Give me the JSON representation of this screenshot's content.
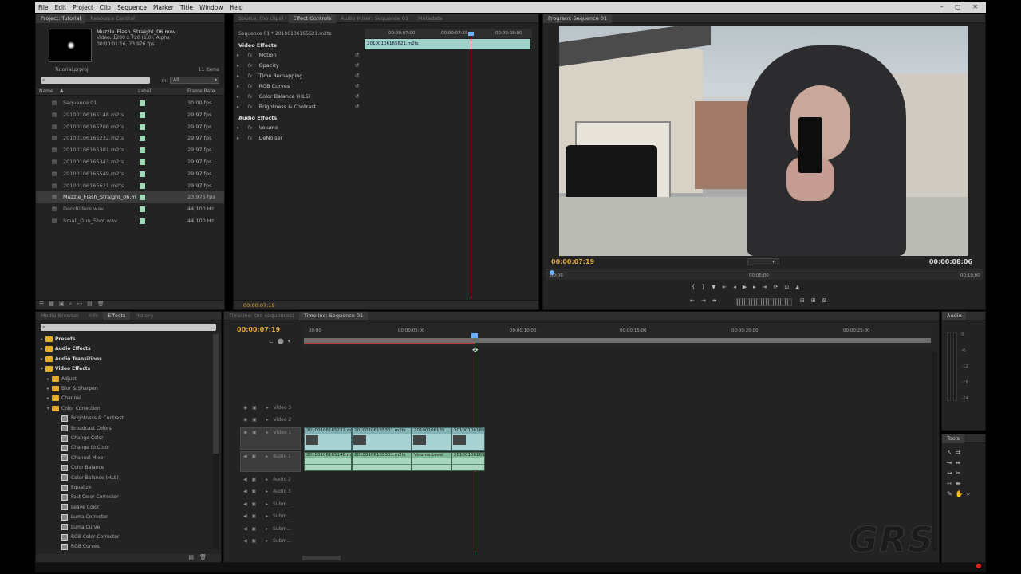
{
  "menu": [
    "File",
    "Edit",
    "Project",
    "Clip",
    "Sequence",
    "Marker",
    "Title",
    "Window",
    "Help"
  ],
  "project_panel": {
    "tabs": [
      "Project: Tutorial",
      "Resource Central"
    ],
    "preview": {
      "name": "Muzzle_Flash_Straight_06.mov",
      "info1": "Video, 1280 x 720 (1.0), Alpha",
      "info2": "00:00:01:16, 23.976 fps"
    },
    "project_file": "Tutorial.prproj",
    "item_count": "11 Items",
    "in_label": "In:",
    "in_value": "All",
    "columns": [
      "Name",
      "Label",
      "Frame Rate"
    ],
    "items": [
      {
        "name": "Sequence 01",
        "rate": "30.00 fps"
      },
      {
        "name": "20100106165148.m2ts",
        "rate": "29.97 fps"
      },
      {
        "name": "20100106165208.m2ts",
        "rate": "29.97 fps"
      },
      {
        "name": "20100106165232.m2ts",
        "rate": "29.97 fps"
      },
      {
        "name": "20100106165301.m2ts",
        "rate": "29.97 fps"
      },
      {
        "name": "20100106165343.m2ts",
        "rate": "29.97 fps"
      },
      {
        "name": "20100106165549.m2ts",
        "rate": "29.97 fps"
      },
      {
        "name": "20100106165621.m2ts",
        "rate": "29.97 fps"
      },
      {
        "name": "Muzzle_Flash_Straight_06.m",
        "rate": "23.976 fps"
      },
      {
        "name": "DarkRiders.wav",
        "rate": "44,100 Hz"
      },
      {
        "name": "Small_Gun_Shot.wav",
        "rate": "44,100 Hz"
      }
    ]
  },
  "effect_controls": {
    "tabs": [
      "Source: (no clips)",
      "Effect Controls",
      "Audio Mixer: Sequence 01",
      "Metadata"
    ],
    "clip_path": "Sequence 01 * 20100106165621.m2ts",
    "clip_name": "20100106165621.m2ts",
    "ruler": [
      "00:00:07:00",
      "00:00:07:15",
      "00:00:08:00"
    ],
    "video_header": "Video Effects",
    "audio_header": "Audio Effects",
    "video_effects": [
      "Motion",
      "Opacity",
      "Time Remapping",
      "RGB Curves",
      "Color Balance (HLS)",
      "Brightness & Contrast"
    ],
    "audio_effects": [
      "Volume",
      "DeNoiser"
    ],
    "timecode": "00:00:07:19"
  },
  "program_monitor": {
    "tab": "Program: Sequence 01",
    "timecode": "00:00:07:19",
    "duration": "00:00:08:06",
    "ruler": [
      "00:00",
      "00:05:00",
      "00:10:00"
    ]
  },
  "effects_panel": {
    "tabs": [
      "Media Browser",
      "Info",
      "Effects",
      "History"
    ],
    "tree": [
      {
        "label": "Presets",
        "kind": "folder",
        "level": 0
      },
      {
        "label": "Audio Effects",
        "kind": "folder",
        "level": 0
      },
      {
        "label": "Audio Transitions",
        "kind": "folder",
        "level": 0
      },
      {
        "label": "Video Effects",
        "kind": "folder",
        "level": 0
      },
      {
        "label": "Adjust",
        "kind": "folder",
        "level": 1
      },
      {
        "label": "Blur & Sharpen",
        "kind": "folder",
        "level": 1
      },
      {
        "label": "Channel",
        "kind": "folder",
        "level": 1
      },
      {
        "label": "Color Correction",
        "kind": "folder",
        "level": 1
      },
      {
        "label": "Brightness & Contrast",
        "kind": "fx",
        "level": 2
      },
      {
        "label": "Broadcast Colors",
        "kind": "fx",
        "level": 2
      },
      {
        "label": "Change Color",
        "kind": "fx",
        "level": 2
      },
      {
        "label": "Change to Color",
        "kind": "fx",
        "level": 2
      },
      {
        "label": "Channel Mixer",
        "kind": "fx",
        "level": 2
      },
      {
        "label": "Color Balance",
        "kind": "fx",
        "level": 2
      },
      {
        "label": "Color Balance (HLS)",
        "kind": "fx",
        "level": 2
      },
      {
        "label": "Equalize",
        "kind": "fx",
        "level": 2
      },
      {
        "label": "Fast Color Corrector",
        "kind": "fx",
        "level": 2
      },
      {
        "label": "Leave Color",
        "kind": "fx",
        "level": 2
      },
      {
        "label": "Luma Corrector",
        "kind": "fx",
        "level": 2
      },
      {
        "label": "Luma Curve",
        "kind": "fx",
        "level": 2
      },
      {
        "label": "RGB Color Corrector",
        "kind": "fx",
        "level": 2
      },
      {
        "label": "RGB Curves",
        "kind": "fx",
        "level": 2
      }
    ]
  },
  "timeline": {
    "tabs": [
      "Timeline: (no sequences)",
      "Timeline: Sequence 01"
    ],
    "timecode": "00:00:07:19",
    "ruler": [
      "00:00",
      "00:00:05:00",
      "00:00:10:00",
      "00:00:15:00",
      "00:00:20:00",
      "00:00:25:00"
    ],
    "tracks": [
      "Video 3",
      "Video 2",
      "Video 1",
      "Audio 1",
      "Audio 2",
      "Audio 3",
      "Subm...",
      "Subm...",
      "Subm...",
      "Subm..."
    ],
    "video_clips": [
      "20100106165232.m",
      "20100106165301.m2ts",
      "20100106165",
      "20100106165"
    ],
    "audio_clips": [
      "20100106165148.m",
      "20100106165301.m2ts",
      "Volume:Level",
      "20100106165"
    ]
  },
  "audio_meter": {
    "tab": "Audio",
    "scale": [
      "0",
      "-6",
      "-12",
      "-18",
      "-24"
    ]
  },
  "tools": {
    "tab": "Tools"
  },
  "watermark": "GRS"
}
